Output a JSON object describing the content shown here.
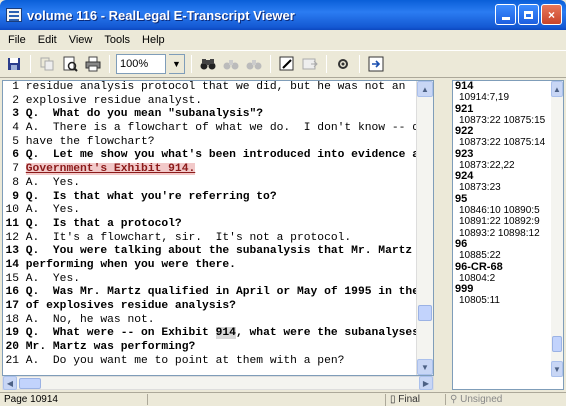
{
  "window": {
    "title": "volume 116 - RealLegal E-Transcript Viewer",
    "minimize_label": "_",
    "close_label": "×"
  },
  "menu": [
    "File",
    "Edit",
    "View",
    "Tools",
    "Help"
  ],
  "toolbar": {
    "zoom_value": "100%",
    "icons": [
      "save-icon",
      "copy-icon",
      "print-preview-icon",
      "print-icon",
      "binoculars-icon",
      "find-next-icon",
      "find-prev-icon",
      "annotate-icon",
      "export-icon",
      "settings-icon",
      "goto-icon"
    ]
  },
  "transcript": {
    "lines": [
      {
        "n": "1",
        "text": "residue analysis protocol that we did, but he was not an"
      },
      {
        "n": "2",
        "text": "explosive residue analyst."
      },
      {
        "n": "3",
        "text": "Q.  What do you mean \"subanalysis\"?"
      },
      {
        "n": "4",
        "text": "A.  There is a flowchart of what we do.  I don't know -- do yo"
      },
      {
        "n": "5",
        "text": "have the flowchart?"
      },
      {
        "n": "6",
        "text": "Q.  Let me show you what's been introduced into evidence as"
      },
      {
        "n": "7",
        "text": "Government's Exhibit 914."
      },
      {
        "n": "8",
        "text": "A.  Yes."
      },
      {
        "n": "9",
        "text": "Q.  Is that what you're referring to?"
      },
      {
        "n": "10",
        "text": "A.  Yes."
      },
      {
        "n": "11",
        "text": "Q.  Is that a protocol?"
      },
      {
        "n": "12",
        "text": "A.  It's a flowchart, sir.  It's not a protocol."
      },
      {
        "n": "13",
        "text": "Q.  You were talking about the subanalysis that Mr. Martz was"
      },
      {
        "n": "14",
        "text": "performing when you were there."
      },
      {
        "n": "15",
        "text": "A.  Yes."
      },
      {
        "n": "16",
        "text": "Q.  Was Mr. Martz qualified in April or May of 1995 in the are"
      },
      {
        "n": "17",
        "text": "of explosives residue analysis?"
      },
      {
        "n": "18",
        "text": "A.  No, he was not."
      },
      {
        "n": "19",
        "text": "Q.  What were -- on Exhibit 914, what were the subanalyses tha"
      },
      {
        "n": "20",
        "text": "Mr. Martz was performing?"
      },
      {
        "n": "21",
        "text": "A.  Do you want me to point at them with a pen?"
      }
    ],
    "line19_a": "Q.  What were -- on Exhibit ",
    "line19_hl": "914",
    "line19_b": ", what were the subanalyses tha"
  },
  "index": [
    {
      "head": "914",
      "refs": [
        "10914:7,19"
      ]
    },
    {
      "head": "921",
      "refs": [
        "10873:22 10875:15"
      ]
    },
    {
      "head": "922",
      "refs": [
        "10873:22 10875:14"
      ]
    },
    {
      "head": "923",
      "refs": [
        "10873:22,22"
      ]
    },
    {
      "head": "924",
      "refs": [
        "10873:23"
      ]
    },
    {
      "head": "95",
      "refs": [
        "10846:10 10890:5",
        "10891:22 10892:9",
        "10893:2 10898:12"
      ]
    },
    {
      "head": "96",
      "refs": [
        "10885:22"
      ]
    },
    {
      "head": "96-CR-68",
      "refs": [
        "10804:2"
      ]
    },
    {
      "head": "999",
      "refs": [
        "10805:11"
      ]
    }
  ],
  "status": {
    "page": "Page 10914",
    "final": "Final",
    "unsigned": "Unsigned"
  }
}
